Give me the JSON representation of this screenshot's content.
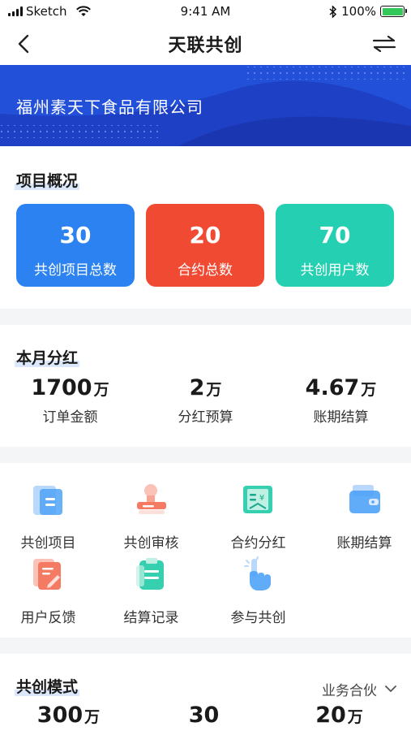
{
  "status_bar": {
    "carrier": "Sketch",
    "time": "9:41 AM",
    "battery": "100%",
    "battery_level": 1.0
  },
  "nav": {
    "title": "天联共创"
  },
  "banner": {
    "company": "福州素天下食品有限公司",
    "color": "#1e40c4"
  },
  "overview": {
    "title": "项目概况",
    "cards": [
      {
        "value": "30",
        "label": "共创项目总数",
        "color": "#2b82f0"
      },
      {
        "value": "20",
        "label": "合约总数",
        "color": "#f14a33"
      },
      {
        "value": "70",
        "label": "共创用户数",
        "color": "#25d0b2"
      }
    ]
  },
  "monthly": {
    "title": "本月分红",
    "stats": [
      {
        "value": "1700",
        "unit": "万",
        "label": "订单金额"
      },
      {
        "value": "2",
        "unit": "万",
        "label": "分红预算"
      },
      {
        "value": "4.67",
        "unit": "万",
        "label": "账期结算"
      }
    ]
  },
  "menu": {
    "items": [
      {
        "label": "共创项目",
        "icon": "folder-icon"
      },
      {
        "label": "共创审核",
        "icon": "stamp-icon"
      },
      {
        "label": "合约分红",
        "icon": "contract-yuan-icon"
      },
      {
        "label": "账期结算",
        "icon": "wallet-icon"
      },
      {
        "label": "用户反馈",
        "icon": "feedback-edit-icon"
      },
      {
        "label": "结算记录",
        "icon": "record-icon"
      },
      {
        "label": "参与共创",
        "icon": "hand-pointer-icon"
      }
    ]
  },
  "mode": {
    "title": "共创模式",
    "dropdown": "业务合伙",
    "stats": [
      {
        "value": "300",
        "unit": "万"
      },
      {
        "value": "30",
        "unit": ""
      },
      {
        "value": "20",
        "unit": "万"
      }
    ]
  }
}
